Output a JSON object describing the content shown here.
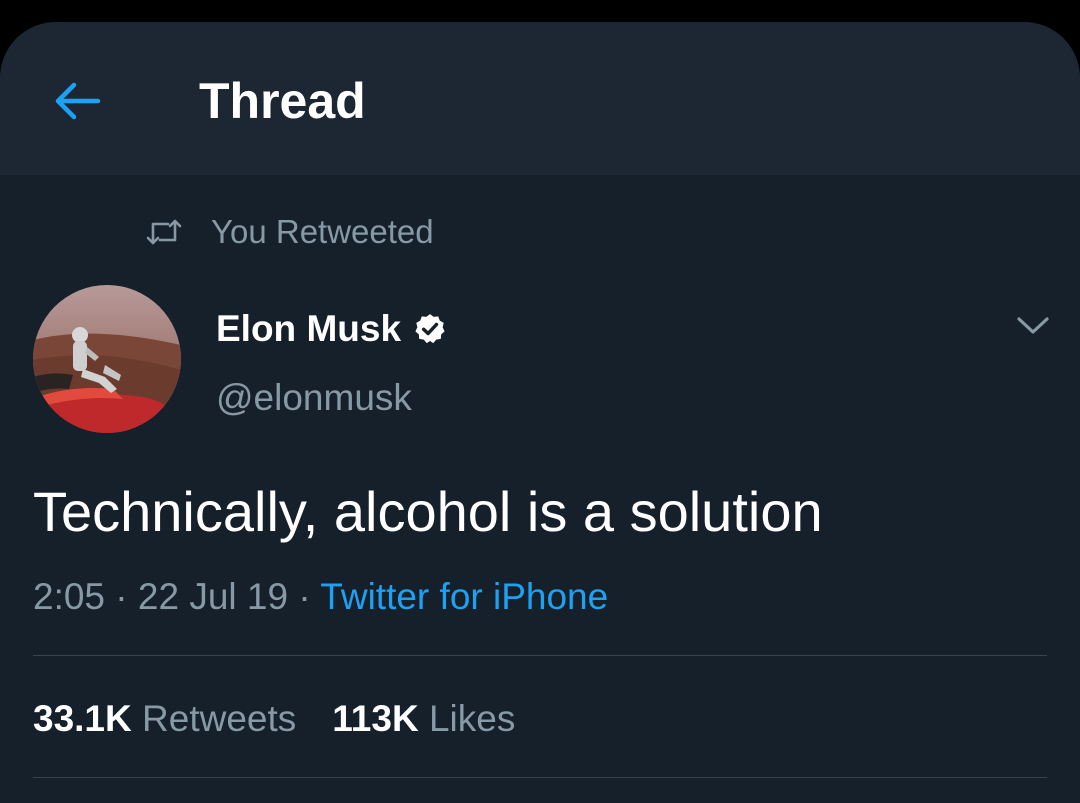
{
  "colors": {
    "background": "#15202b",
    "header_bg": "#1c2733",
    "accent": "#1da1f2",
    "text_primary": "#ffffff",
    "text_secondary": "#8899a6",
    "divider": "#38444d"
  },
  "header": {
    "back_icon": "arrow-left-icon",
    "title": "Thread"
  },
  "social_context": {
    "icon": "retweet-icon",
    "label": "You Retweeted"
  },
  "tweet": {
    "author": {
      "name": "Elon Musk",
      "verified": true,
      "verified_icon": "verified-badge-icon",
      "handle": "@elonmusk"
    },
    "menu_icon": "chevron-down-icon",
    "text": "Technically, alcohol is a solution",
    "time": "2:05",
    "separator": "·",
    "date": "22 Jul 19",
    "source": "Twitter for iPhone",
    "stats": {
      "retweets_count": "33.1K",
      "retweets_label": "Retweets",
      "likes_count": "113K",
      "likes_label": "Likes"
    }
  }
}
